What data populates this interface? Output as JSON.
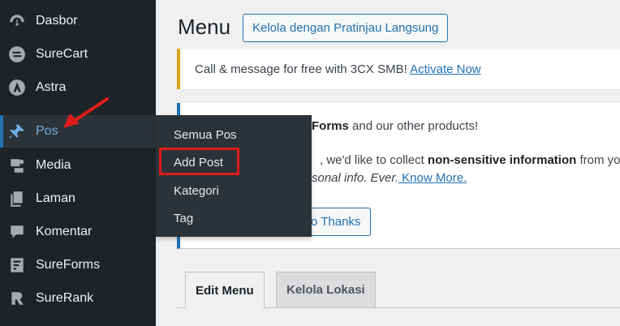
{
  "sidebar": {
    "items": [
      {
        "label": "Dasbor",
        "icon": "dashboard-icon"
      },
      {
        "label": "SureCart",
        "icon": "surecart-icon"
      },
      {
        "label": "Astra",
        "icon": "astra-icon"
      },
      {
        "label": "Pos",
        "icon": "pin-icon"
      },
      {
        "label": "Media",
        "icon": "media-icon"
      },
      {
        "label": "Laman",
        "icon": "pages-icon"
      },
      {
        "label": "Komentar",
        "icon": "comment-icon"
      },
      {
        "label": "SureForms",
        "icon": "sureforms-icon"
      },
      {
        "label": "SureRank",
        "icon": "surerank-icon"
      }
    ],
    "active_index": 3
  },
  "flyout": {
    "items": [
      "Semua Pos",
      "Add Post",
      "Kategori",
      "Tag"
    ],
    "highlighted_index": 1
  },
  "header": {
    "title": "Menu",
    "live_preview_button": "Kelola dengan Pratinjau Langsung"
  },
  "notice_3cx": {
    "text": "Call & message for free with 3CX SMB! ",
    "link": "Activate Now"
  },
  "notice_tracking": {
    "line1_bold": "Forms",
    "line1_rest": " and our other products!",
    "line2_pre": ", we'd like to collect ",
    "line2_bold": "non-sensitive information",
    "line2_post": " from yo",
    "line3_italic": "sonal info. Ever.",
    "line3_link": " Know More.",
    "button": "o Thanks"
  },
  "tabs": [
    {
      "label": "Edit Menu",
      "active": true
    },
    {
      "label": "Kelola Lokasi",
      "active": false
    }
  ],
  "colors": {
    "sidebar_bg": "#1d2327",
    "flyout_bg": "#2c3338",
    "accent": "#2271b1",
    "active_text": "#72aee6",
    "highlight": "#e01b1b",
    "warning": "#dba617"
  }
}
